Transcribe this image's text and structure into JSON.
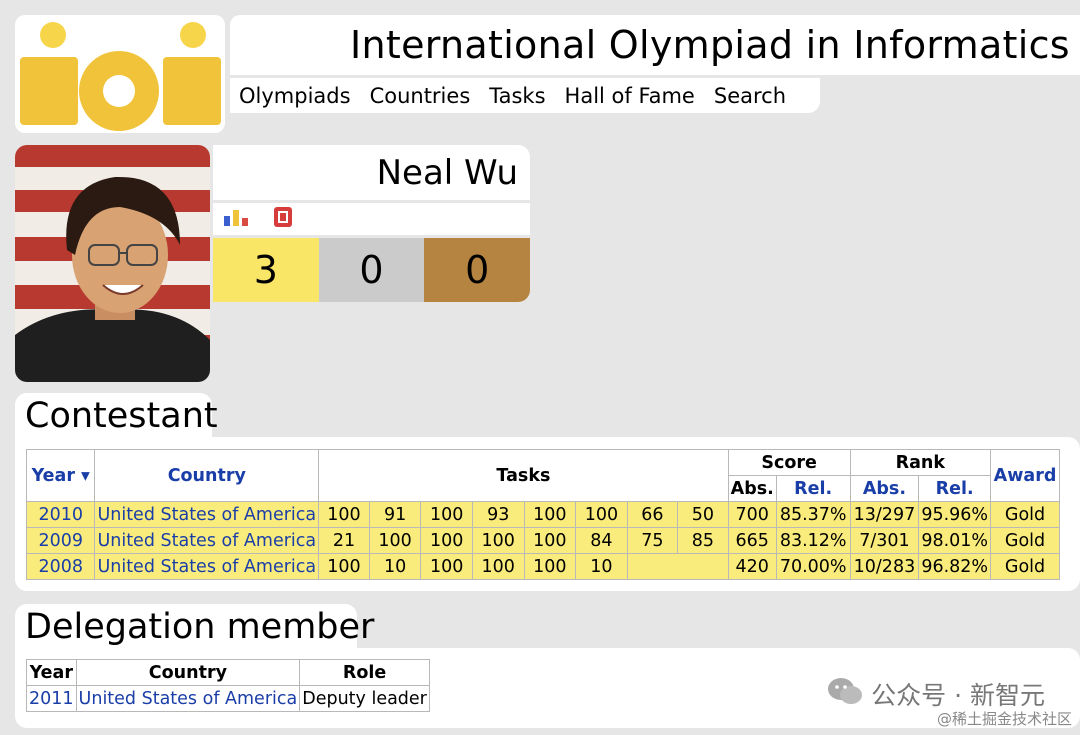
{
  "header": {
    "title": "International Olympiad in Informatics –",
    "logo_text": "ioi",
    "nav": [
      "Olympiads",
      "Countries",
      "Tasks",
      "Hall of Fame",
      "Search"
    ]
  },
  "profile": {
    "name": "Neal Wu",
    "medals": {
      "gold": "3",
      "silver": "0",
      "bronze": "0"
    }
  },
  "contestant": {
    "heading": "Contestant",
    "headers": {
      "year": "Year ▾",
      "country": "Country",
      "tasks": "Tasks",
      "score": "Score",
      "rank": "Rank",
      "award": "Award",
      "abs": "Abs.",
      "rel": "Rel.",
      "rank_abs": "Abs.",
      "rank_rel": "Rel."
    },
    "rows": [
      {
        "year": "2010",
        "country": "United States of America",
        "tasks": [
          "100",
          "91",
          "100",
          "93",
          "100",
          "100",
          "66",
          "50"
        ],
        "score_abs": "700",
        "score_rel": "85.37%",
        "rank_abs": "13/297",
        "rank_rel": "95.96%",
        "award": "Gold"
      },
      {
        "year": "2009",
        "country": "United States of America",
        "tasks": [
          "21",
          "100",
          "100",
          "100",
          "100",
          "84",
          "75",
          "85"
        ],
        "score_abs": "665",
        "score_rel": "83.12%",
        "rank_abs": "7/301",
        "rank_rel": "98.01%",
        "award": "Gold"
      },
      {
        "year": "2008",
        "country": "United States of America",
        "tasks": [
          "100",
          "10",
          "100",
          "100",
          "100",
          "10",
          "",
          ""
        ],
        "score_abs": "420",
        "score_rel": "70.00%",
        "rank_abs": "10/283",
        "rank_rel": "96.82%",
        "award": "Gold"
      }
    ]
  },
  "delegation": {
    "heading": "Delegation member",
    "headers": {
      "year": "Year",
      "country": "Country",
      "role": "Role"
    },
    "rows": [
      {
        "year": "2011",
        "country": "United States of America",
        "role": "Deputy leader"
      }
    ]
  },
  "watermark": {
    "main": "公众号 · 新智元",
    "sub": "@稀土掘金技术社区"
  },
  "colors": {
    "gold": "#f9e566",
    "silver": "#cbcbcb",
    "bronze": "#b58440",
    "row_highlight": "#f9ec7c",
    "link": "#1a3ea8"
  }
}
